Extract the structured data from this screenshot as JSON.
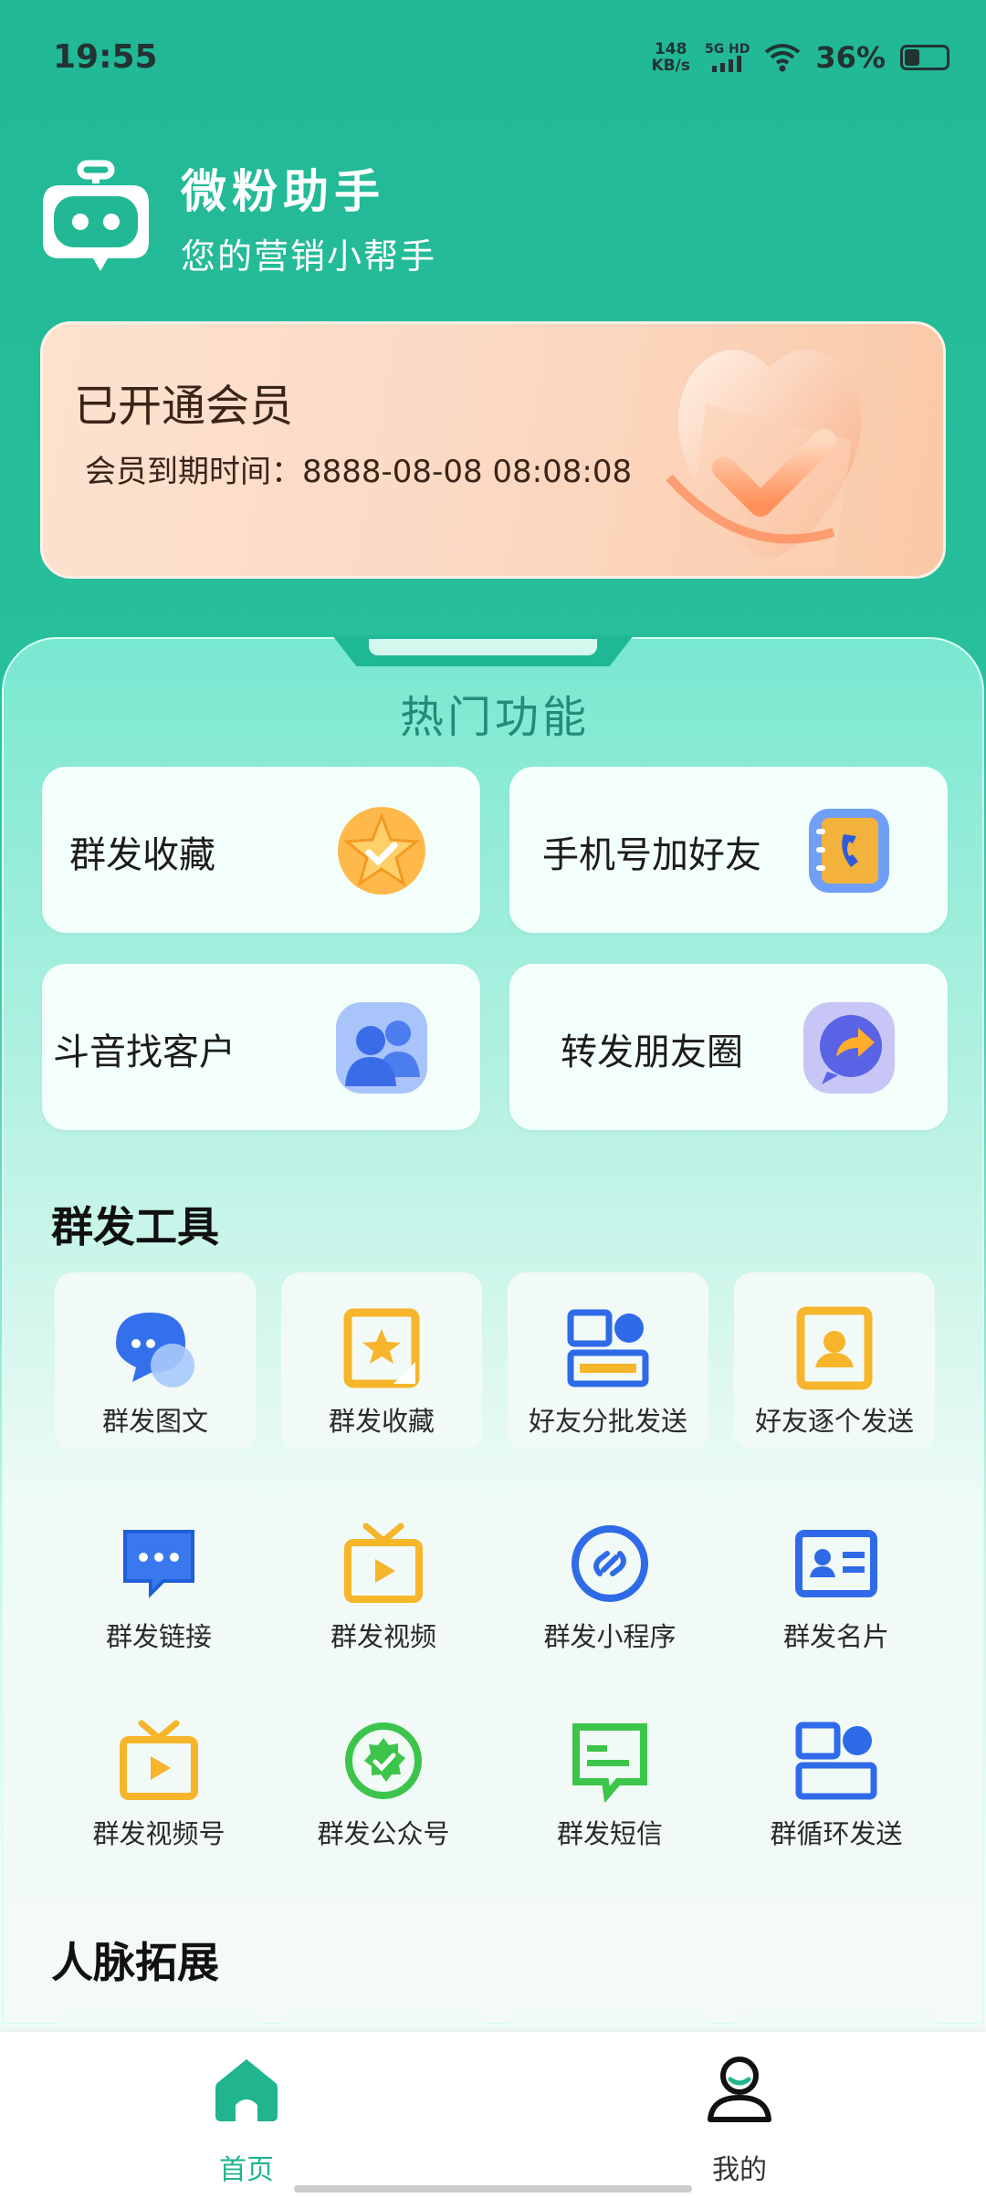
{
  "status_bar": {
    "time": "19:55",
    "net_speed_value": "148",
    "net_speed_unit": "KB/s",
    "signal_label_top": "5G HD",
    "battery_percent": "36%",
    "battery_level": 0.36
  },
  "header": {
    "app_name": "微粉助手",
    "slogan": "您的营销小帮手"
  },
  "member": {
    "title": "已开通会员",
    "expire": "会员到期时间：8888-08-08 08:08:08"
  },
  "hot": {
    "title": "热门功能",
    "items": [
      {
        "label": "群发收藏",
        "icon": "star-badge-icon"
      },
      {
        "label": "手机号加好友",
        "icon": "contact-book-icon"
      },
      {
        "label": "斗音找客户",
        "icon": "users-icon"
      },
      {
        "label": "转发朋友圈",
        "icon": "share-bubble-icon"
      }
    ]
  },
  "mass_tools": {
    "title": "群发工具",
    "items": [
      {
        "label": "群发图文",
        "icon": "chat-bubble-icon"
      },
      {
        "label": "群发收藏",
        "icon": "star-frame-icon"
      },
      {
        "label": "好友分批发送",
        "icon": "batch-layout-icon"
      },
      {
        "label": "好友逐个发送",
        "icon": "contact-card-icon"
      },
      {
        "label": "群发链接",
        "icon": "message-dots-icon"
      },
      {
        "label": "群发视频",
        "icon": "tv-play-icon"
      },
      {
        "label": "群发小程序",
        "icon": "mini-program-icon"
      },
      {
        "label": "群发名片",
        "icon": "business-card-icon"
      },
      {
        "label": "群发视频号",
        "icon": "video-channel-icon"
      },
      {
        "label": "群发公众号",
        "icon": "official-account-icon"
      },
      {
        "label": "群发短信",
        "icon": "sms-icon"
      },
      {
        "label": "群循环发送",
        "icon": "loop-send-icon"
      }
    ]
  },
  "network": {
    "title": "人脉拓展"
  },
  "tabbar": {
    "home_label": "首页",
    "mine_label": "我的",
    "active_color": "#20b48f"
  }
}
